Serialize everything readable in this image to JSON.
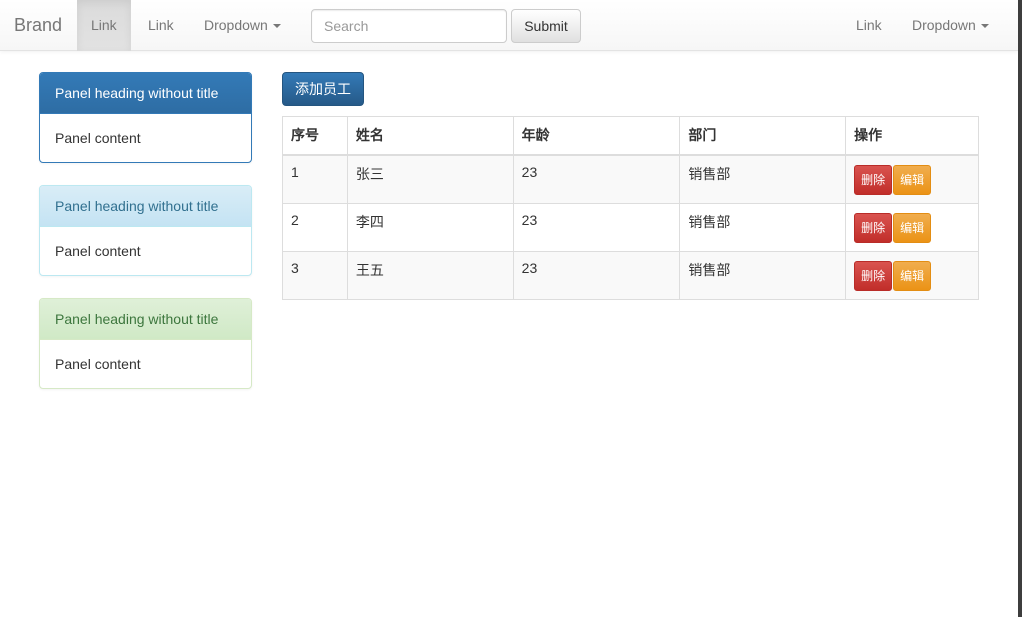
{
  "navbar": {
    "brand": "Brand",
    "link_active": "Link",
    "link_2": "Link",
    "dropdown_1": "Dropdown",
    "search_placeholder": "Search",
    "submit_label": "Submit",
    "link_right": "Link",
    "dropdown_right": "Dropdown"
  },
  "panels": [
    {
      "heading": "Panel heading without title",
      "content": "Panel content",
      "style": "primary"
    },
    {
      "heading": "Panel heading without title",
      "content": "Panel content",
      "style": "info"
    },
    {
      "heading": "Panel heading without title",
      "content": "Panel content",
      "style": "success"
    }
  ],
  "main": {
    "add_button_label": "添加员工",
    "table": {
      "headers": [
        "序号",
        "姓名",
        "年龄",
        "部门",
        "操作"
      ],
      "rows": [
        {
          "id": "1",
          "name": "张三",
          "age": "23",
          "dept": "销售部"
        },
        {
          "id": "2",
          "name": "李四",
          "age": "23",
          "dept": "销售部"
        },
        {
          "id": "3",
          "name": "王五",
          "age": "23",
          "dept": "销售部"
        }
      ],
      "delete_label": "删除",
      "edit_label": "编辑"
    }
  },
  "colors": {
    "primary": "#337ab7",
    "danger": "#d9534f",
    "warning": "#f0ad4e",
    "info_bg": "#d9edf7",
    "success_bg": "#dff0d8"
  }
}
